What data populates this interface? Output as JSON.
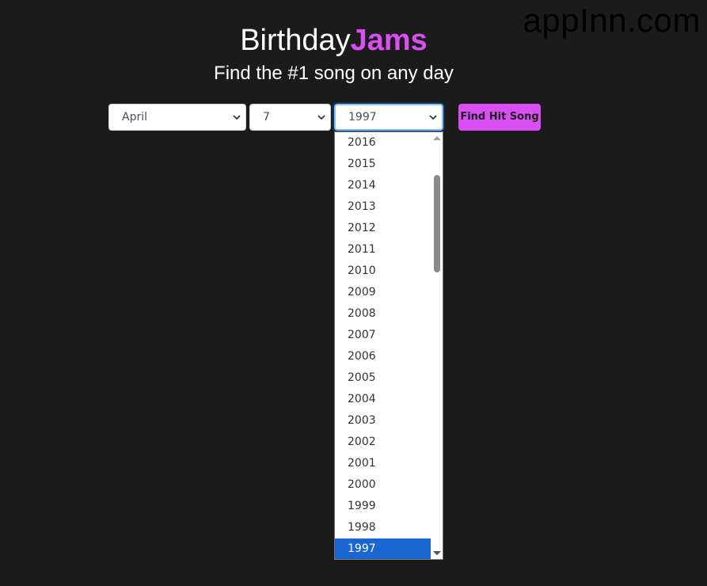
{
  "watermark": "appInn.com",
  "header": {
    "title_main": "Birthday",
    "title_accent": "Jams",
    "subtitle": "Find the #1 song on any day"
  },
  "form": {
    "month": {
      "value": "April"
    },
    "day": {
      "value": "7"
    },
    "year": {
      "value": "1997",
      "options": [
        "2016",
        "2015",
        "2014",
        "2013",
        "2012",
        "2011",
        "2010",
        "2009",
        "2008",
        "2007",
        "2006",
        "2005",
        "2004",
        "2003",
        "2002",
        "2001",
        "2000",
        "1999",
        "1998",
        "1997"
      ],
      "selected_index": 19
    },
    "submit_label": "Find Hit Song"
  },
  "colors": {
    "background": "#1b1b1b",
    "accent": "#d94ff3",
    "selected_option": "#1a67d2"
  }
}
